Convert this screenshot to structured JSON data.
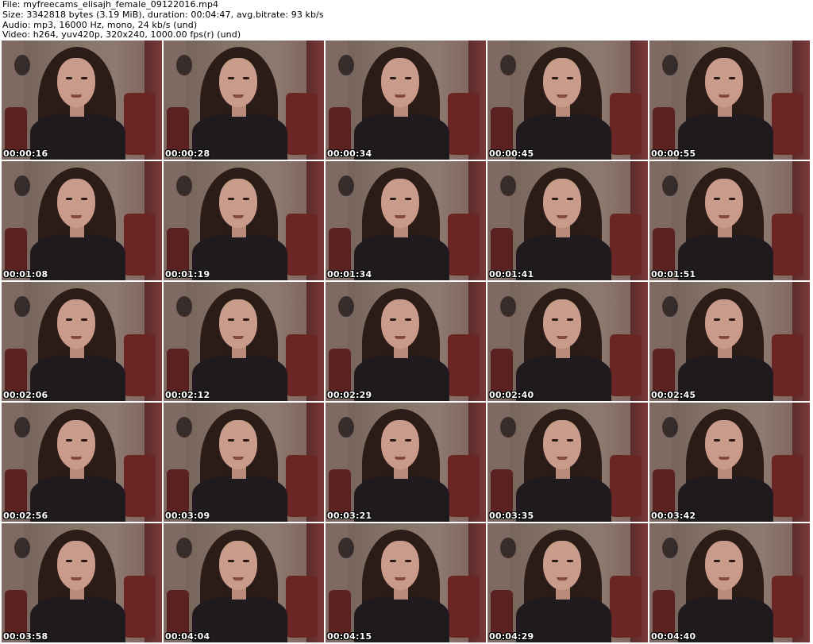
{
  "header": {
    "file": "File: myfreecams_elisajh_female_09122016.mp4",
    "size": "Size: 3342818 bytes (3.19 MiB), duration: 00:04:47, avg.bitrate: 93 kb/s",
    "audio": "Audio: mp3, 16000 Hz, mono, 24 kb/s (und)",
    "video": "Video: h264, yuv420p, 320x240, 1000.00 fps(r) (und)"
  },
  "thumbnails": [
    {
      "timestamp": "00:00:16"
    },
    {
      "timestamp": "00:00:28"
    },
    {
      "timestamp": "00:00:34"
    },
    {
      "timestamp": "00:00:45"
    },
    {
      "timestamp": "00:00:55"
    },
    {
      "timestamp": "00:01:08"
    },
    {
      "timestamp": "00:01:19"
    },
    {
      "timestamp": "00:01:34"
    },
    {
      "timestamp": "00:01:41"
    },
    {
      "timestamp": "00:01:51"
    },
    {
      "timestamp": "00:02:06"
    },
    {
      "timestamp": "00:02:12"
    },
    {
      "timestamp": "00:02:29"
    },
    {
      "timestamp": "00:02:40"
    },
    {
      "timestamp": "00:02:45"
    },
    {
      "timestamp": "00:02:56"
    },
    {
      "timestamp": "00:03:09"
    },
    {
      "timestamp": "00:03:21"
    },
    {
      "timestamp": "00:03:35"
    },
    {
      "timestamp": "00:03:42"
    },
    {
      "timestamp": "00:03:58"
    },
    {
      "timestamp": "00:04:04"
    },
    {
      "timestamp": "00:04:15"
    },
    {
      "timestamp": "00:04:29"
    },
    {
      "timestamp": "00:04:40"
    }
  ]
}
